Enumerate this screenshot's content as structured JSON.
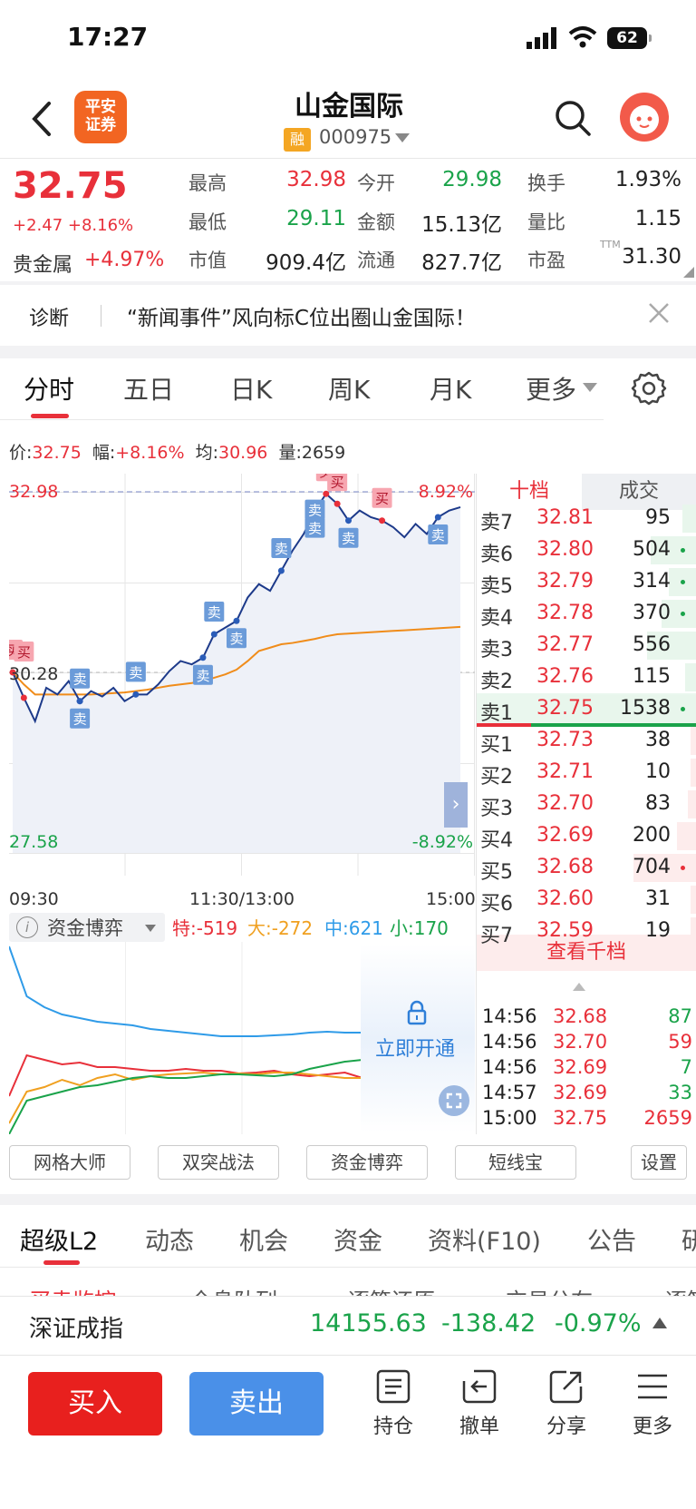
{
  "status": {
    "time": "17:27",
    "battery": "62"
  },
  "header": {
    "broker_logo": "平安\n证券",
    "stock_name": "山金国际",
    "rong": "融",
    "code": "000975"
  },
  "quote": {
    "price": "32.75",
    "change": "+2.47 +8.16%",
    "sector_label": "贵金属",
    "sector_change": "+4.97%",
    "rows": [
      [
        {
          "label": "最高",
          "value": "32.98",
          "color": "red"
        },
        {
          "label": "今开",
          "value": "29.98",
          "color": "green"
        },
        {
          "label": "换手",
          "value": "1.93%",
          "color": "dark"
        }
      ],
      [
        {
          "label": "最低",
          "value": "29.11",
          "color": "green"
        },
        {
          "label": "金额",
          "value": "15.13亿",
          "color": "dark"
        },
        {
          "label": "量比",
          "value": "1.15",
          "color": "dark"
        }
      ],
      [
        {
          "label": "市值",
          "value": "909.4亿",
          "color": "dark"
        },
        {
          "label": "流通",
          "value": "827.7亿",
          "color": "dark"
        },
        {
          "label": "市盈",
          "value": "31.30",
          "color": "dark",
          "sup": "TTM"
        }
      ]
    ]
  },
  "diagnosis": {
    "label": "诊断",
    "text": "“新闻事件”风向标C位出圈山金国际！"
  },
  "period_tabs": [
    "分时",
    "五日",
    "日K",
    "周K",
    "月K",
    "更多"
  ],
  "info_line": {
    "price_label": "价:",
    "price": "32.75",
    "amp_label": "幅:",
    "amp": "+8.16%",
    "avg_label": "均:",
    "avg": "30.96",
    "vol_label": "量:",
    "vol": "2659"
  },
  "chart": {
    "top_price": "32.98",
    "top_pct": "8.92%",
    "mid_price": "30.28",
    "bottom_price": "27.58",
    "bottom_pct": "-8.92%",
    "times": [
      "09:30",
      "11:30/13:00",
      "15:00"
    ],
    "buy_tag": "买",
    "sell_tag": "卖",
    "colors": {
      "price_line": "#1d3a8a",
      "avg_line": "#f08c1a",
      "up": "#e8303a",
      "down": "#1aa34a"
    }
  },
  "chart_data": {
    "type": "line",
    "title": "",
    "xlabel": "",
    "ylabel": "",
    "ylim": [
      27.58,
      32.98
    ],
    "x_ticks": [
      "09:30",
      "11:30/13:00",
      "15:00"
    ],
    "series": [
      {
        "name": "",
        "values": [
          30.28,
          29.9,
          29.55,
          30.05,
          29.95,
          30.15,
          29.85,
          30.0,
          29.92,
          30.05,
          29.85,
          29.95,
          29.95,
          30.1,
          30.3,
          30.45,
          30.4,
          30.5,
          30.85,
          30.95,
          31.05,
          31.4,
          31.6,
          31.5,
          31.8,
          32.1,
          32.35,
          32.7,
          32.95,
          32.8,
          32.55,
          32.7,
          32.6,
          32.55,
          32.45,
          32.3,
          32.5,
          32.35,
          32.6,
          32.7,
          32.75
        ]
      },
      {
        "name": "",
        "values": [
          30.28,
          30.1,
          29.95,
          29.95,
          29.95,
          29.95,
          29.95,
          29.95,
          29.96,
          29.97,
          29.98,
          30.0,
          30.02,
          30.05,
          30.08,
          30.1,
          30.12,
          30.15,
          30.2,
          30.25,
          30.32,
          30.45,
          30.6,
          30.65,
          30.7,
          30.72,
          30.75,
          30.78,
          30.82,
          30.85,
          30.86,
          30.87,
          30.88,
          30.89,
          30.9,
          30.91,
          30.92,
          30.93,
          30.94,
          30.95,
          30.96
        ]
      }
    ]
  },
  "order_book": {
    "tab_ten": "十档",
    "tab_deal": "成交",
    "asks": [
      {
        "label": "卖7",
        "price": "32.81",
        "vol": "95",
        "bar": 0.1
      },
      {
        "label": "卖6",
        "price": "32.80",
        "vol": "504",
        "bar": 0.33,
        "dot": "green"
      },
      {
        "label": "卖5",
        "price": "32.79",
        "vol": "314",
        "bar": 0.2,
        "dot": "green"
      },
      {
        "label": "卖4",
        "price": "32.78",
        "vol": "370",
        "bar": 0.25,
        "dot": "green"
      },
      {
        "label": "卖3",
        "price": "32.77",
        "vol": "556",
        "bar": 0.36
      },
      {
        "label": "卖2",
        "price": "32.76",
        "vol": "115",
        "bar": 0.08
      },
      {
        "label": "卖1",
        "price": "32.75",
        "vol": "1538",
        "bar": 1.0,
        "dot": "green"
      }
    ],
    "bids": [
      {
        "label": "买1",
        "price": "32.73",
        "vol": "38",
        "bar": 0.03
      },
      {
        "label": "买2",
        "price": "32.71",
        "vol": "10",
        "bar": 0.01
      },
      {
        "label": "买3",
        "price": "32.70",
        "vol": "83",
        "bar": 0.06
      },
      {
        "label": "买4",
        "price": "32.69",
        "vol": "200",
        "bar": 0.14
      },
      {
        "label": "买5",
        "price": "32.68",
        "vol": "704",
        "bar": 0.46,
        "dot": "red"
      },
      {
        "label": "买6",
        "price": "32.60",
        "vol": "31",
        "bar": 0.02
      },
      {
        "label": "买7",
        "price": "32.59",
        "vol": "19",
        "bar": 0.01
      }
    ],
    "view_more": "查看千档",
    "trades": [
      {
        "time": "14:56",
        "price": "32.68",
        "vol": "87",
        "color": "green"
      },
      {
        "time": "14:56",
        "price": "32.70",
        "vol": "59",
        "color": "red"
      },
      {
        "time": "14:56",
        "price": "32.69",
        "vol": "7",
        "color": "green"
      },
      {
        "time": "14:57",
        "price": "32.69",
        "vol": "33",
        "color": "green"
      },
      {
        "time": "15:00",
        "price": "32.75",
        "vol": "2659",
        "color": "red"
      }
    ]
  },
  "funds": {
    "title": "资金博弈",
    "items": [
      {
        "text": "特:-519",
        "color": "#e8303a"
      },
      {
        "text": "大:-272",
        "color": "#f0a020"
      },
      {
        "text": "中:621",
        "color": "#2f9be8"
      },
      {
        "text": "小:170",
        "color": "#1aa34a"
      }
    ],
    "unlock": "立即开通"
  },
  "tools": [
    "网格大师",
    "双突战法",
    "资金博弈",
    "短线宝",
    "设置"
  ],
  "lower_tabs": [
    "超级L2",
    "动态",
    "机会",
    "资金",
    "资料(F10)",
    "公告",
    "研"
  ],
  "sub_strip": [
    "买卖监控",
    "全息队列",
    "逐笔还原",
    "交易分布",
    "逐笔"
  ],
  "index": {
    "name": "深证成指",
    "value": "14155.63",
    "change": "-138.42",
    "pct": "-0.97%"
  },
  "actions": {
    "buy": "买入",
    "sell": "卖出",
    "position": "持仓",
    "cancel": "撤单",
    "share": "分享",
    "more": "更多"
  }
}
